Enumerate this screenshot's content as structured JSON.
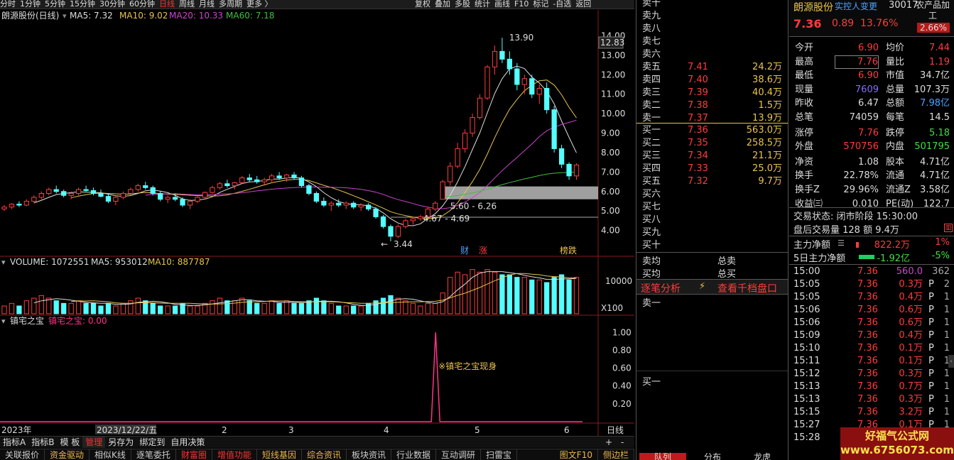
{
  "toolbar": {
    "items": [
      "分时",
      "1分钟",
      "5分钟",
      "15分钟",
      "30分钟",
      "60分钟",
      "日线",
      "周线",
      "月线",
      "多周期",
      "更多 〉"
    ],
    "active": "日线",
    "right_items": [
      "复权",
      "叠加",
      "多股",
      "统计",
      "画线",
      "F10",
      "标记",
      "-自选",
      "返回"
    ]
  },
  "chart": {
    "stock_title": "朗源股份(日线)",
    "ma_labels": [
      {
        "text": "MA5: 7.32",
        "color": "#dddddd"
      },
      {
        "text": "MA10: 9.02",
        "color": "#e9c34c"
      },
      {
        "text": "MA20: 10.33",
        "color": "#cc44cc"
      },
      {
        "text": "MA60: 7.18",
        "color": "#44bb44"
      }
    ],
    "price_axis": [
      "14.00",
      "13.00",
      "12.00",
      "11.00",
      "10.00",
      "9.00",
      "8.00",
      "7.00",
      "6.00",
      "5.00",
      "4.00"
    ],
    "current_price_tag": "12.83",
    "high_label": "13.90",
    "low_label": "3.44",
    "gap_label_1": "5.60 - 6.26",
    "gap_label_2": "4.67 - 4.69",
    "markers": [
      {
        "text": "财",
        "color": "#4aa3ff"
      },
      {
        "text": "涨",
        "color": "#ff3c3c"
      },
      {
        "text": "榜跌",
        "color": "#e9c34c"
      }
    ],
    "volume_label": "VOLUME: 1072551",
    "vol_ma5": "MA5: 953012",
    "vol_ma10": "MA10: 887787",
    "vol_axis": "10000",
    "vol_unit": "X100",
    "indicator_name": "镇宅之宝",
    "indicator_value": "镇宅之宝: 0.00",
    "indicator_axis": [
      "1.00",
      "0.80",
      "0.60",
      "0.40",
      "0.20"
    ],
    "indicator_note": "※镇宅之宝现身",
    "date_axis": [
      "2023年",
      "2023/12/22/五",
      "2",
      "3",
      "4",
      "5",
      "6"
    ],
    "period_label": "日线",
    "candles": [
      [
        5.1,
        5.3,
        5.0,
        5.2
      ],
      [
        5.2,
        5.4,
        5.1,
        5.35
      ],
      [
        5.35,
        5.5,
        5.2,
        5.3
      ],
      [
        5.3,
        5.6,
        5.25,
        5.5
      ],
      [
        5.5,
        5.8,
        5.4,
        5.7
      ],
      [
        5.7,
        6.0,
        5.6,
        5.9
      ],
      [
        5.9,
        6.2,
        5.8,
        6.1
      ],
      [
        6.1,
        6.3,
        5.9,
        6.0
      ],
      [
        6.0,
        6.1,
        5.7,
        5.8
      ],
      [
        5.8,
        6.0,
        5.6,
        5.9
      ],
      [
        5.9,
        6.2,
        5.8,
        6.1
      ],
      [
        6.1,
        6.3,
        6.0,
        6.05
      ],
      [
        6.05,
        6.2,
        5.8,
        5.9
      ],
      [
        5.9,
        6.1,
        5.7,
        5.75
      ],
      [
        5.75,
        5.9,
        5.4,
        5.5
      ],
      [
        5.5,
        5.8,
        5.3,
        5.7
      ],
      [
        5.7,
        6.0,
        5.6,
        5.9
      ],
      [
        5.9,
        6.2,
        5.8,
        6.1
      ],
      [
        6.1,
        6.4,
        6.0,
        6.3
      ],
      [
        6.3,
        6.5,
        6.1,
        6.2
      ],
      [
        6.2,
        6.3,
        5.8,
        5.9
      ],
      [
        5.9,
        6.0,
        5.5,
        5.6
      ],
      [
        5.6,
        5.8,
        5.4,
        5.7
      ],
      [
        5.7,
        5.9,
        5.5,
        5.6
      ],
      [
        5.6,
        5.7,
        5.2,
        5.3
      ],
      [
        5.3,
        5.6,
        5.1,
        5.5
      ],
      [
        5.5,
        5.8,
        5.4,
        5.7
      ],
      [
        5.7,
        6.0,
        5.6,
        5.95
      ],
      [
        5.95,
        6.3,
        5.9,
        6.2
      ],
      [
        6.2,
        6.5,
        6.1,
        6.4
      ],
      [
        6.4,
        6.6,
        6.2,
        6.3
      ],
      [
        6.3,
        6.5,
        6.1,
        6.45
      ],
      [
        6.45,
        6.8,
        6.4,
        6.7
      ],
      [
        6.7,
        6.9,
        6.5,
        6.6
      ],
      [
        6.6,
        6.8,
        6.4,
        6.5
      ],
      [
        6.5,
        6.7,
        6.3,
        6.6
      ],
      [
        6.6,
        6.9,
        6.5,
        6.8
      ],
      [
        6.8,
        7.0,
        6.6,
        6.7
      ],
      [
        6.7,
        6.9,
        6.5,
        6.85
      ],
      [
        6.85,
        7.0,
        6.6,
        6.7
      ],
      [
        6.7,
        6.8,
        6.2,
        6.3
      ],
      [
        6.3,
        6.4,
        5.8,
        5.9
      ],
      [
        5.9,
        6.0,
        5.4,
        5.5
      ],
      [
        5.5,
        5.7,
        5.2,
        5.3
      ],
      [
        5.3,
        5.5,
        5.0,
        5.4
      ],
      [
        5.4,
        5.6,
        5.2,
        5.3
      ],
      [
        5.3,
        5.5,
        5.1,
        5.4
      ],
      [
        5.4,
        5.5,
        5.1,
        5.2
      ],
      [
        5.2,
        5.4,
        5.0,
        5.3
      ],
      [
        5.3,
        5.4,
        5.0,
        5.1
      ],
      [
        5.1,
        5.2,
        4.6,
        4.7
      ],
      [
        4.7,
        4.8,
        4.1,
        4.2
      ],
      [
        4.2,
        4.3,
        3.44,
        3.7
      ],
      [
        3.7,
        4.3,
        3.6,
        4.2
      ],
      [
        4.2,
        4.6,
        4.1,
        4.5
      ],
      [
        4.5,
        4.7,
        4.3,
        4.6
      ],
      [
        4.6,
        4.8,
        4.5,
        4.7
      ],
      [
        4.7,
        5.2,
        4.69,
        5.1
      ],
      [
        5.1,
        5.5,
        5.0,
        5.4
      ],
      [
        5.6,
        6.6,
        5.6,
        6.5
      ],
      [
        6.5,
        7.5,
        6.3,
        7.3
      ],
      [
        7.3,
        8.5,
        7.2,
        8.2
      ],
      [
        8.2,
        9.2,
        8.0,
        9.0
      ],
      [
        9.0,
        10.0,
        8.8,
        9.8
      ],
      [
        9.8,
        11.0,
        9.7,
        10.8
      ],
      [
        10.8,
        12.5,
        10.7,
        12.4
      ],
      [
        12.4,
        13.5,
        12.0,
        13.2
      ],
      [
        13.2,
        13.9,
        12.6,
        12.8
      ],
      [
        12.8,
        13.2,
        12.0,
        12.3
      ],
      [
        12.3,
        12.6,
        11.2,
        11.5
      ],
      [
        11.5,
        12.0,
        11.0,
        11.8
      ],
      [
        11.8,
        12.0,
        10.8,
        11.0
      ],
      [
        11.0,
        11.5,
        10.5,
        11.3
      ],
      [
        11.3,
        11.6,
        10.0,
        10.2
      ],
      [
        10.2,
        10.4,
        8.0,
        8.2
      ],
      [
        8.2,
        8.4,
        7.2,
        7.4
      ],
      [
        7.4,
        7.5,
        6.6,
        6.8
      ],
      [
        6.8,
        7.45,
        6.6,
        7.36
      ]
    ],
    "volumes": [
      3,
      4,
      3,
      5,
      6,
      7,
      6,
      5,
      4,
      4,
      5,
      4,
      4,
      3,
      4,
      3,
      4,
      5,
      6,
      5,
      4,
      3,
      3,
      3,
      4,
      3,
      3,
      4,
      5,
      6,
      5,
      5,
      6,
      5,
      4,
      4,
      5,
      4,
      5,
      4,
      4,
      5,
      6,
      5,
      4,
      3,
      3,
      3,
      3,
      4,
      5,
      6,
      7,
      6,
      5,
      4,
      3,
      4,
      4,
      8,
      14,
      16,
      15,
      17,
      16,
      17,
      16,
      15,
      15,
      14,
      14,
      13,
      13,
      12,
      14,
      15,
      13,
      14
    ],
    "indicator_spike_index": 59
  },
  "bottom_bar1": [
    "指标A",
    "指标B",
    "模 板",
    "管理",
    "另存为",
    "绑定到",
    "自用决策"
  ],
  "bottom_bar1_active": "管理",
  "bottom_bar2": [
    "关联报价",
    "资金驱动",
    "相似K线",
    "逐笔委托",
    "财富圈",
    "增值功能",
    "短线基因",
    "综合资讯",
    "板块资讯",
    "行业数据",
    "互动调研",
    "扫雷宝"
  ],
  "bottom_bar2_right": [
    "图文F10",
    "侧边栏"
  ],
  "orderbook": {
    "sell_levels": [
      {
        "name": "卖十",
        "price": "",
        "vol": ""
      },
      {
        "name": "卖九",
        "price": "",
        "vol": ""
      },
      {
        "name": "卖八",
        "price": "",
        "vol": ""
      },
      {
        "name": "卖七",
        "price": "",
        "vol": ""
      },
      {
        "name": "卖六",
        "price": "",
        "vol": ""
      },
      {
        "name": "卖五",
        "price": "7.41",
        "vol": "24.2万"
      },
      {
        "name": "卖四",
        "price": "7.40",
        "vol": "38.6万"
      },
      {
        "name": "卖三",
        "price": "7.39",
        "vol": "40.4万"
      },
      {
        "name": "卖二",
        "price": "7.38",
        "vol": "1.5万"
      },
      {
        "name": "卖一",
        "price": "7.37",
        "vol": "13.9万"
      }
    ],
    "buy_levels": [
      {
        "name": "买一",
        "price": "7.36",
        "vol": "563.0万"
      },
      {
        "name": "买二",
        "price": "7.35",
        "vol": "258.5万"
      },
      {
        "name": "买三",
        "price": "7.34",
        "vol": "21.1万"
      },
      {
        "name": "买四",
        "price": "7.33",
        "vol": "25.0万"
      },
      {
        "name": "买五",
        "price": "7.32",
        "vol": "9.7万"
      },
      {
        "name": "买六",
        "price": "",
        "vol": ""
      },
      {
        "name": "买七",
        "price": "",
        "vol": ""
      },
      {
        "name": "买八",
        "price": "",
        "vol": ""
      },
      {
        "name": "买九",
        "price": "",
        "vol": ""
      },
      {
        "name": "买十",
        "price": "",
        "vol": ""
      }
    ],
    "avg_sell": "卖均",
    "total_sell": "总卖",
    "avg_buy": "买均",
    "total_buy": "总买",
    "tab_detail": "逐笔分析",
    "tab_queue": "查看千档盘口",
    "queue_sell": "卖一",
    "queue_buy": "买一",
    "bottom_tabs": [
      "队列",
      "分布",
      "龙虎"
    ]
  },
  "quote": {
    "name": "朗源股份",
    "tag": "实控人变更",
    "code": "30017",
    "industry": "农产品加工",
    "price": "7.36",
    "change": "0.89",
    "pct": "13.76%",
    "small_pct": "2.66%",
    "rows": [
      [
        "今开",
        "6.90",
        "均价",
        "7.44"
      ],
      [
        "最高",
        "7.76",
        "量比",
        "1.19"
      ],
      [
        "最低",
        "6.90",
        "市值",
        "34.7亿"
      ],
      [
        "现量",
        "7609",
        "总量",
        "107.3万"
      ],
      [
        "昨收",
        "6.47",
        "总额",
        "7.98亿"
      ],
      [
        "总笔",
        "74059",
        "每笔",
        "14.5"
      ],
      [
        "涨停",
        "7.76",
        "跌停",
        "5.18"
      ],
      [
        "外盘",
        "570756",
        "内盘",
        "501795"
      ],
      [
        "净资",
        "1.08",
        "股本",
        "4.71亿"
      ],
      [
        "换手",
        "22.78%",
        "流通",
        "4.71亿"
      ],
      [
        "换手Z",
        "29.96%",
        "流通Z",
        "3.58亿"
      ],
      [
        "收益㈢",
        "0.010",
        "PE(动)",
        "122.7"
      ]
    ],
    "trade_status": "交易状态: 闭市阶段 15:30:00",
    "after_hours": "盘后交易量 128 额 9.4万",
    "main_flow_label": "主力净额",
    "main_flow_value": "822.2万",
    "main_flow_pct": "1%",
    "flow5_label": "5日主力净额",
    "flow5_value": "-1.92亿",
    "flow5_pct": "-5%"
  },
  "ticks": [
    {
      "t": "15:00",
      "p": "7.36",
      "v": "560.0万",
      "bs": "",
      "c": "362"
    },
    {
      "t": "15:05",
      "p": "7.36",
      "v": "0.3万",
      "bs": "P",
      "c": "2"
    },
    {
      "t": "15:05",
      "p": "7.36",
      "v": "0.4万",
      "bs": "P",
      "c": "1"
    },
    {
      "t": "15:06",
      "p": "7.36",
      "v": "0.6万",
      "bs": "P",
      "c": "1"
    },
    {
      "t": "15:06",
      "p": "7.36",
      "v": "0.6万",
      "bs": "P",
      "c": "1"
    },
    {
      "t": "15:09",
      "p": "7.36",
      "v": "0.4万",
      "bs": "P",
      "c": "1"
    },
    {
      "t": "15:10",
      "p": "7.36",
      "v": "0.1万",
      "bs": "P",
      "c": "1"
    },
    {
      "t": "15:11",
      "p": "7.36",
      "v": "0.1万",
      "bs": "P",
      "c": "1"
    },
    {
      "t": "15:12",
      "p": "7.36",
      "v": "0.3万",
      "bs": "P",
      "c": "1"
    },
    {
      "t": "15:13",
      "p": "7.36",
      "v": "0.7万",
      "bs": "P",
      "c": "1"
    },
    {
      "t": "15:13",
      "p": "7.36",
      "v": "0.3万",
      "bs": "P",
      "c": "1"
    },
    {
      "t": "15:15",
      "p": "7.36",
      "v": "3.2万",
      "bs": "P",
      "c": "1"
    },
    {
      "t": "15:27",
      "p": "7.36",
      "v": "0.1万",
      "bs": "P",
      "c": "1"
    },
    {
      "t": "15:28",
      "p": "7.36",
      "v": "0.1万",
      "bs": "P",
      "c": "1"
    }
  ],
  "watermark": {
    "line1": "好福气公式网",
    "line2": "www.6756073.com"
  }
}
